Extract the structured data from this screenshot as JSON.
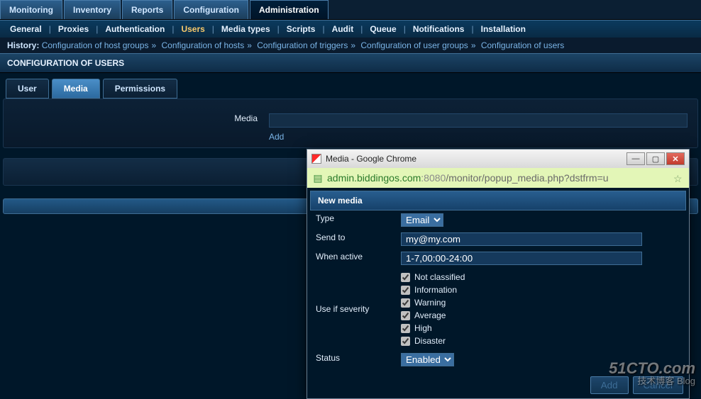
{
  "mainnav": {
    "tabs": [
      "Monitoring",
      "Inventory",
      "Reports",
      "Configuration",
      "Administration"
    ],
    "active": "Administration"
  },
  "subnav": {
    "items": [
      "General",
      "Proxies",
      "Authentication",
      "Users",
      "Media types",
      "Scripts",
      "Audit",
      "Queue",
      "Notifications",
      "Installation"
    ],
    "current": "Users"
  },
  "history": {
    "label": "History:",
    "items": [
      "Configuration of host groups",
      "Configuration of hosts",
      "Configuration of triggers",
      "Configuration of user groups",
      "Configuration of users"
    ]
  },
  "title": "CONFIGURATION OF USERS",
  "cfg_tabs": {
    "items": [
      "User",
      "Media",
      "Permissions"
    ],
    "active": "Media"
  },
  "form": {
    "media_label": "Media",
    "add_link": "Add",
    "add_btn": "Add"
  },
  "popup": {
    "window_title": "Media - Google Chrome",
    "url": {
      "host": "admin.biddingos.com",
      "port": ":8080",
      "path": "/monitor/popup_media.php?dstfrm=u"
    },
    "section_title": "New media",
    "labels": {
      "type": "Type",
      "send_to": "Send to",
      "when_active": "When active",
      "use_if_severity": "Use if severity",
      "status": "Status"
    },
    "values": {
      "type": "Email",
      "send_to": "my@my.com",
      "when_active": "1-7,00:00-24:00",
      "status": "Enabled"
    },
    "severities": [
      "Not classified",
      "Information",
      "Warning",
      "Average",
      "High",
      "Disaster"
    ],
    "buttons": {
      "add": "Add",
      "cancel": "Cancel"
    }
  },
  "watermark": {
    "main": "51CTO.com",
    "sub": "技术博客    Blog"
  }
}
